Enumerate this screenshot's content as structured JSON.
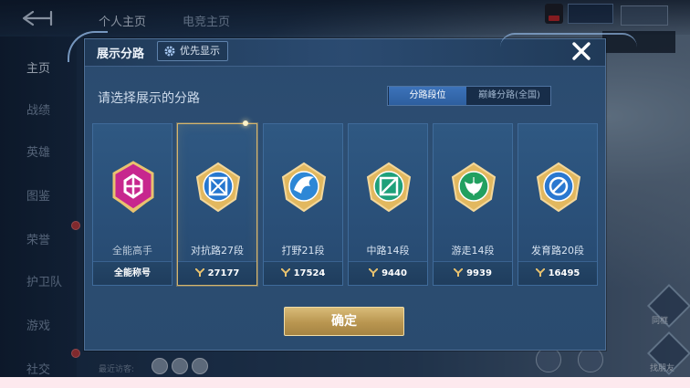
{
  "background": {
    "top_tabs": [
      "个人主页",
      "电竞主页"
    ],
    "right_labels": [
      "同框",
      "找朋友"
    ],
    "recent_visitors_label": "最近访客:"
  },
  "sidebar": {
    "items": [
      {
        "label": "主页",
        "active": true
      },
      {
        "label": "战绩",
        "active": false
      },
      {
        "label": "英雄",
        "active": false
      },
      {
        "label": "图鉴",
        "active": false
      },
      {
        "label": "荣誉",
        "active": false
      },
      {
        "label": "护卫队",
        "active": false
      },
      {
        "label": "游戏",
        "active": false
      },
      {
        "label": "社交",
        "active": false
      }
    ]
  },
  "dialog": {
    "title": "展示分路",
    "priority_button": "优先显示",
    "subtitle": "请选择展示的分路",
    "tabs": [
      {
        "label": "分路段位",
        "selected": true
      },
      {
        "label": "巅峰分路(全国)",
        "selected": false
      }
    ],
    "cards": [
      {
        "label": "全能高手",
        "footer": "全能称号",
        "emblem": "all-round-emblem-icon",
        "color": "#c7278e",
        "selected": false
      },
      {
        "label": "对抗路27段",
        "score": "27177",
        "emblem": "clash-lane-emblem-icon",
        "color": "#2677cf",
        "selected": true
      },
      {
        "label": "打野21段",
        "score": "17524",
        "emblem": "jungle-emblem-icon",
        "color": "#2d87d6",
        "selected": false
      },
      {
        "label": "中路14段",
        "score": "9440",
        "emblem": "mid-lane-emblem-icon",
        "color": "#1ea07a",
        "selected": false
      },
      {
        "label": "游走14段",
        "score": "9939",
        "emblem": "roam-emblem-icon",
        "color": "#22a060",
        "selected": false
      },
      {
        "label": "发育路20段",
        "score": "16495",
        "emblem": "farm-lane-emblem-icon",
        "color": "#2a78d0",
        "selected": false
      }
    ],
    "confirm_label": "确定"
  },
  "colors": {
    "gold": "#d6b56c",
    "panel": "#2d4e73",
    "active_tab": "#2d5f9f"
  }
}
